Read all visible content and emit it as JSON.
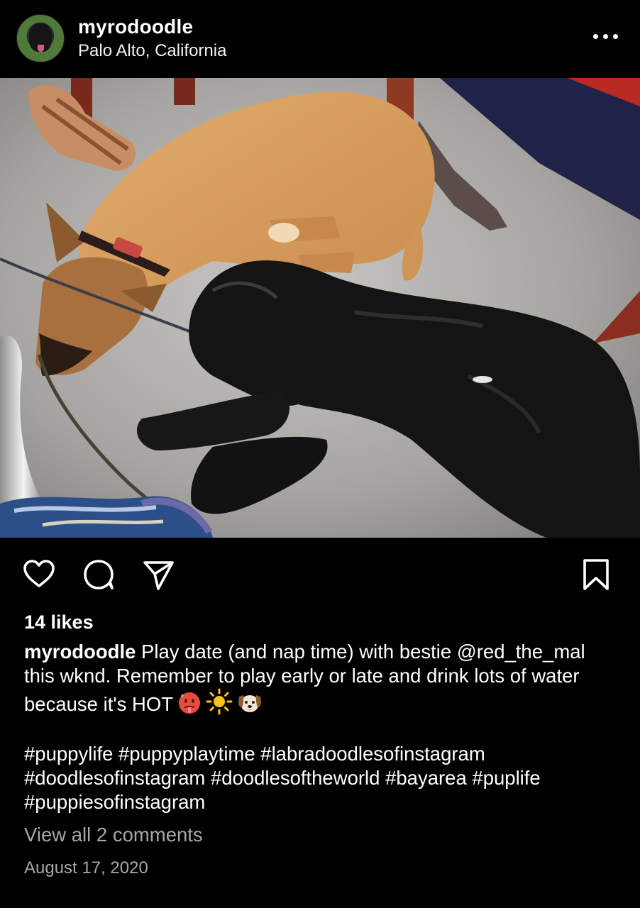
{
  "post": {
    "username": "myrodoodle",
    "location": "Palo Alto, California",
    "likes": "14 likes",
    "caption_username": "myrodoodle",
    "caption_text": "Play date (and nap time) with bestie @red_the_mal this wknd. Remember to play early or late and drink lots of water because it's HOT",
    "hashtags": "#puppylife #puppyplaytime #labradoodlesofinstagram #doodlesofinstagram #doodlesoftheworld #bayarea #puplife #puppiesofinstagram",
    "view_comments": "View all 2 comments",
    "date": "August 17, 2020"
  },
  "icons": {
    "more": "more-dots-icon",
    "like": "heart-icon",
    "comment": "comment-bubble-icon",
    "share": "paper-plane-icon",
    "save": "bookmark-icon",
    "caption_emojis": [
      "hot-face-emoji",
      "sun-emoji",
      "dog-face-emoji"
    ]
  },
  "colors": {
    "background": "#000000",
    "text": "#ffffff",
    "muted_text": "#a8a8a8"
  }
}
